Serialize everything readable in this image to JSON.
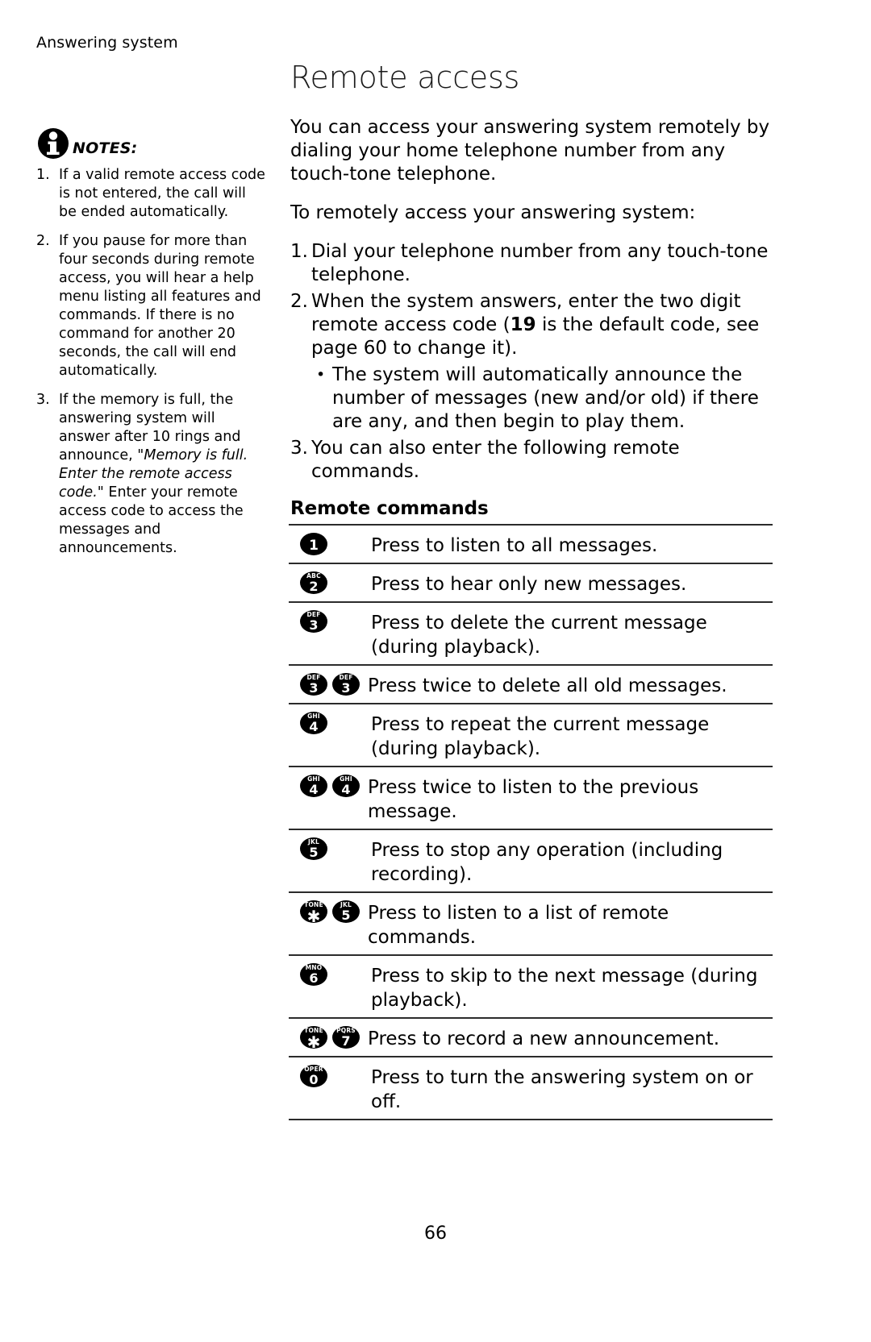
{
  "running_header": "Answering system",
  "notes": {
    "icon": "info-icon",
    "label": "NOTES:",
    "items": [
      {
        "num": "1.",
        "text": "If a valid remote access code is not entered, the call will be ended automatically."
      },
      {
        "num": "2.",
        "text": "If you pause for more than four seconds during remote access, you will hear a help menu listing all features and commands. If there is no command for another 20 seconds, the call will end automatically."
      },
      {
        "num": "3.",
        "pre": "If the memory is full, the answering system will answer after 10 rings and announce, \"",
        "italic": "Memory is full. Enter the remote access code.",
        "post": "\" Enter your remote access code to access the messages and announcements."
      }
    ]
  },
  "main": {
    "title": "Remote access",
    "intro": "You can access your answering system remotely by dialing your home telephone number from any touch-tone telephone.",
    "lead_in": "To remotely access your answering system:",
    "steps": [
      {
        "num": "1.",
        "text": "Dial your telephone number from any touch-tone telephone."
      },
      {
        "num": "2.",
        "pre": "When the system answers, enter the two digit remote access code (",
        "bold": "19",
        "post": " is the default code, see page 60 to change it)."
      },
      {
        "num": "3.",
        "text": "You can also enter the following remote commands."
      }
    ],
    "bullet": {
      "marker": "•",
      "text": "The system will automatically announce the number of messages (new and/or old) if there are any, and then begin to play them."
    },
    "commands_heading": "Remote commands",
    "commands": [
      {
        "keys": [
          {
            "letters": "",
            "digit": "1"
          }
        ],
        "text": "Press to listen to all messages."
      },
      {
        "keys": [
          {
            "letters": "ABC",
            "digit": "2"
          }
        ],
        "text": "Press to hear only new messages."
      },
      {
        "keys": [
          {
            "letters": "DEF",
            "digit": "3"
          }
        ],
        "text": "Press to delete the current message (during playback)."
      },
      {
        "keys": [
          {
            "letters": "DEF",
            "digit": "3"
          },
          {
            "letters": "DEF",
            "digit": "3"
          }
        ],
        "text": "Press twice to delete all old messages."
      },
      {
        "keys": [
          {
            "letters": "GHI",
            "digit": "4"
          }
        ],
        "text": "Press to repeat the current message (during playback)."
      },
      {
        "keys": [
          {
            "letters": "GHI",
            "digit": "4"
          },
          {
            "letters": "GHI",
            "digit": "4"
          }
        ],
        "text": "Press twice to listen to the previous message."
      },
      {
        "keys": [
          {
            "letters": "JKL",
            "digit": "5"
          }
        ],
        "text": "Press to stop any operation (including recording)."
      },
      {
        "keys": [
          {
            "letters": "TONE",
            "digit": "✱"
          },
          {
            "letters": "JKL",
            "digit": "5"
          }
        ],
        "text": "Press to listen to a list of remote commands."
      },
      {
        "keys": [
          {
            "letters": "MNO",
            "digit": "6"
          }
        ],
        "text": "Press to skip to the next message (during playback)."
      },
      {
        "keys": [
          {
            "letters": "TONE",
            "digit": "✱"
          },
          {
            "letters": "PQRS",
            "digit": "7"
          }
        ],
        "text": "Press to record a new announcement."
      },
      {
        "keys": [
          {
            "letters": "OPER",
            "digit": "0"
          }
        ],
        "text": "Press to turn the answering system on or off."
      }
    ]
  },
  "page_number": "66"
}
